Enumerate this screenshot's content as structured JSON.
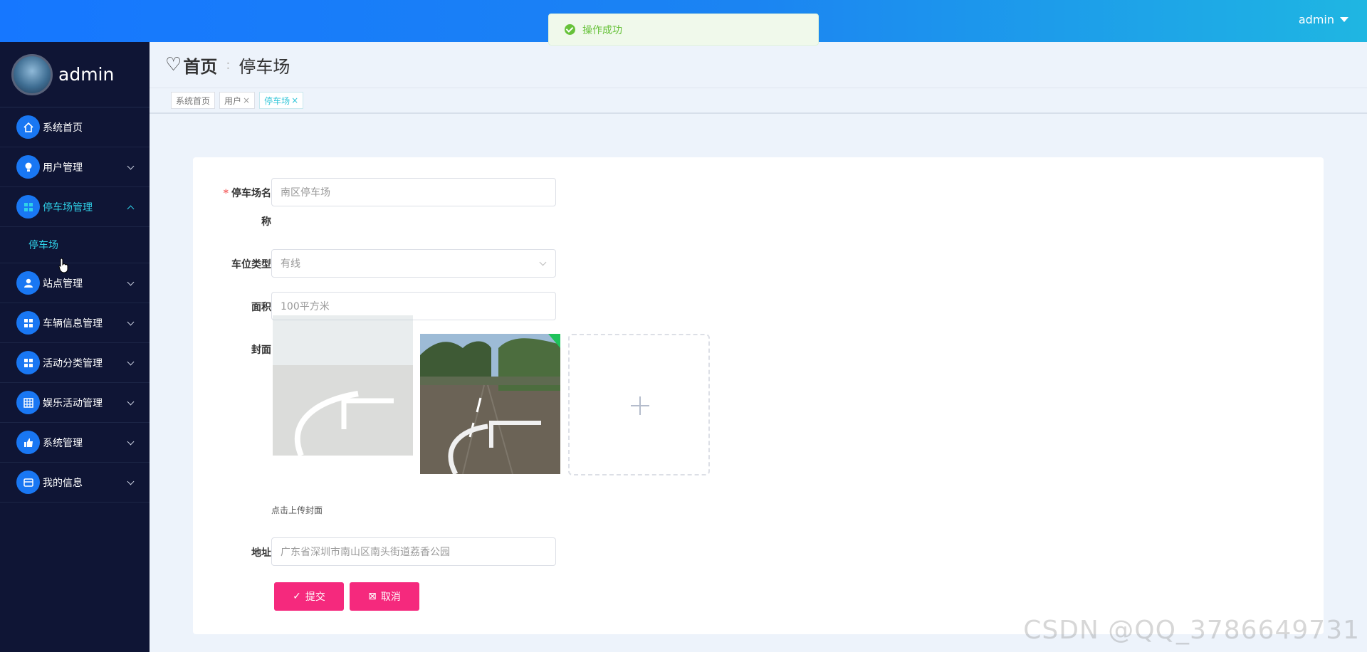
{
  "topbar": {
    "user": "admin"
  },
  "toast": {
    "message": "操作成功"
  },
  "sidebar": {
    "profile_name": "admin",
    "items": [
      {
        "label": "系统首页",
        "icon": "home-icon"
      },
      {
        "label": "用户管理",
        "icon": "bulb-icon"
      },
      {
        "label": "停车场管理",
        "icon": "grid-icon"
      },
      {
        "label": "站点管理",
        "icon": "user-icon"
      },
      {
        "label": "车辆信息管理",
        "icon": "grid-icon"
      },
      {
        "label": "活动分类管理",
        "icon": "grid-icon"
      },
      {
        "label": "娱乐活动管理",
        "icon": "table-icon"
      },
      {
        "label": "系统管理",
        "icon": "thumb-icon"
      },
      {
        "label": "我的信息",
        "icon": "wallet-icon"
      }
    ],
    "submenu": {
      "label": "停车场"
    }
  },
  "breadcrumb": {
    "home": "首页",
    "separator": ":",
    "current": "停车场"
  },
  "tags": [
    {
      "label": "系统首页",
      "closable": false
    },
    {
      "label": "用户",
      "closable": true
    },
    {
      "label": "停车场",
      "closable": true
    }
  ],
  "tag_close_glyph": "×",
  "form": {
    "name_label_1": "停车场名",
    "name_label_2": "称",
    "required_mark": "*",
    "name_placeholder": "南区停车场",
    "slot_type_label": "车位类型",
    "slot_type_value": "有线",
    "area_label": "面积",
    "area_placeholder": "100平方米",
    "cover_label": "封面",
    "cover_hint": "点击上传封面",
    "address_label": "地址",
    "address_placeholder": "广东省深圳市南山区南头街道荔香公园",
    "submit_label": "提交",
    "cancel_label": "取消"
  },
  "watermark": "CSDN @QQ_3786649731",
  "colors": {
    "accent": "#f5297d",
    "active_menu": "#2fd1e8",
    "toast_text": "#67c23a",
    "sidebar_bg": "#0f1535"
  }
}
